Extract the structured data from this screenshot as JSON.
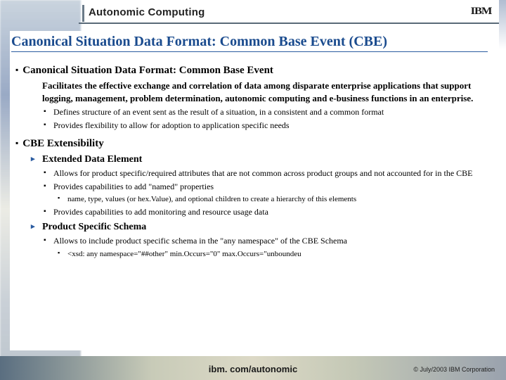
{
  "header": {
    "brand": "Autonomic Computing"
  },
  "logo_text": "IBM",
  "title": "Canonical Situation Data Format: Common Base Event (CBE)",
  "s1": {
    "heading": "Canonical Situation Data Format: Common Base Event",
    "p1": "Facilitates the effective exchange and correlation of data among disparate enterprise applications that support logging, management, problem determination, autonomic computing and e-business functions in an enterprise.",
    "b1": "Defines structure of an event sent as the result of a situation, in a consistent and a common format",
    "b2": "Provides flexibility to allow for adoption to application specific needs"
  },
  "s2": {
    "heading": "CBE Extensibility",
    "sub1": "Extended Data Element",
    "b1": "Allows for product specific/required attributes that are not common across product groups and not accounted for in the CBE",
    "b2": "Provides capabilities to add \"named\" properties",
    "b2a": "name, type, values (or hex.Value), and optional children to create a hierarchy of this elements",
    "b3": "Provides capabilities to add monitoring and resource usage data",
    "sub2": "Product Specific Schema",
    "b4": "Allows to include product specific schema in the \"any namespace\" of the CBE Schema",
    "b4a": "<xsd: any namespace=\"##other\" min.Occurs=\"0\" max.Occurs=\"unboundeu"
  },
  "footer": {
    "url": "ibm. com/autonomic",
    "copy": "© July/2003 IBM Corporation"
  }
}
